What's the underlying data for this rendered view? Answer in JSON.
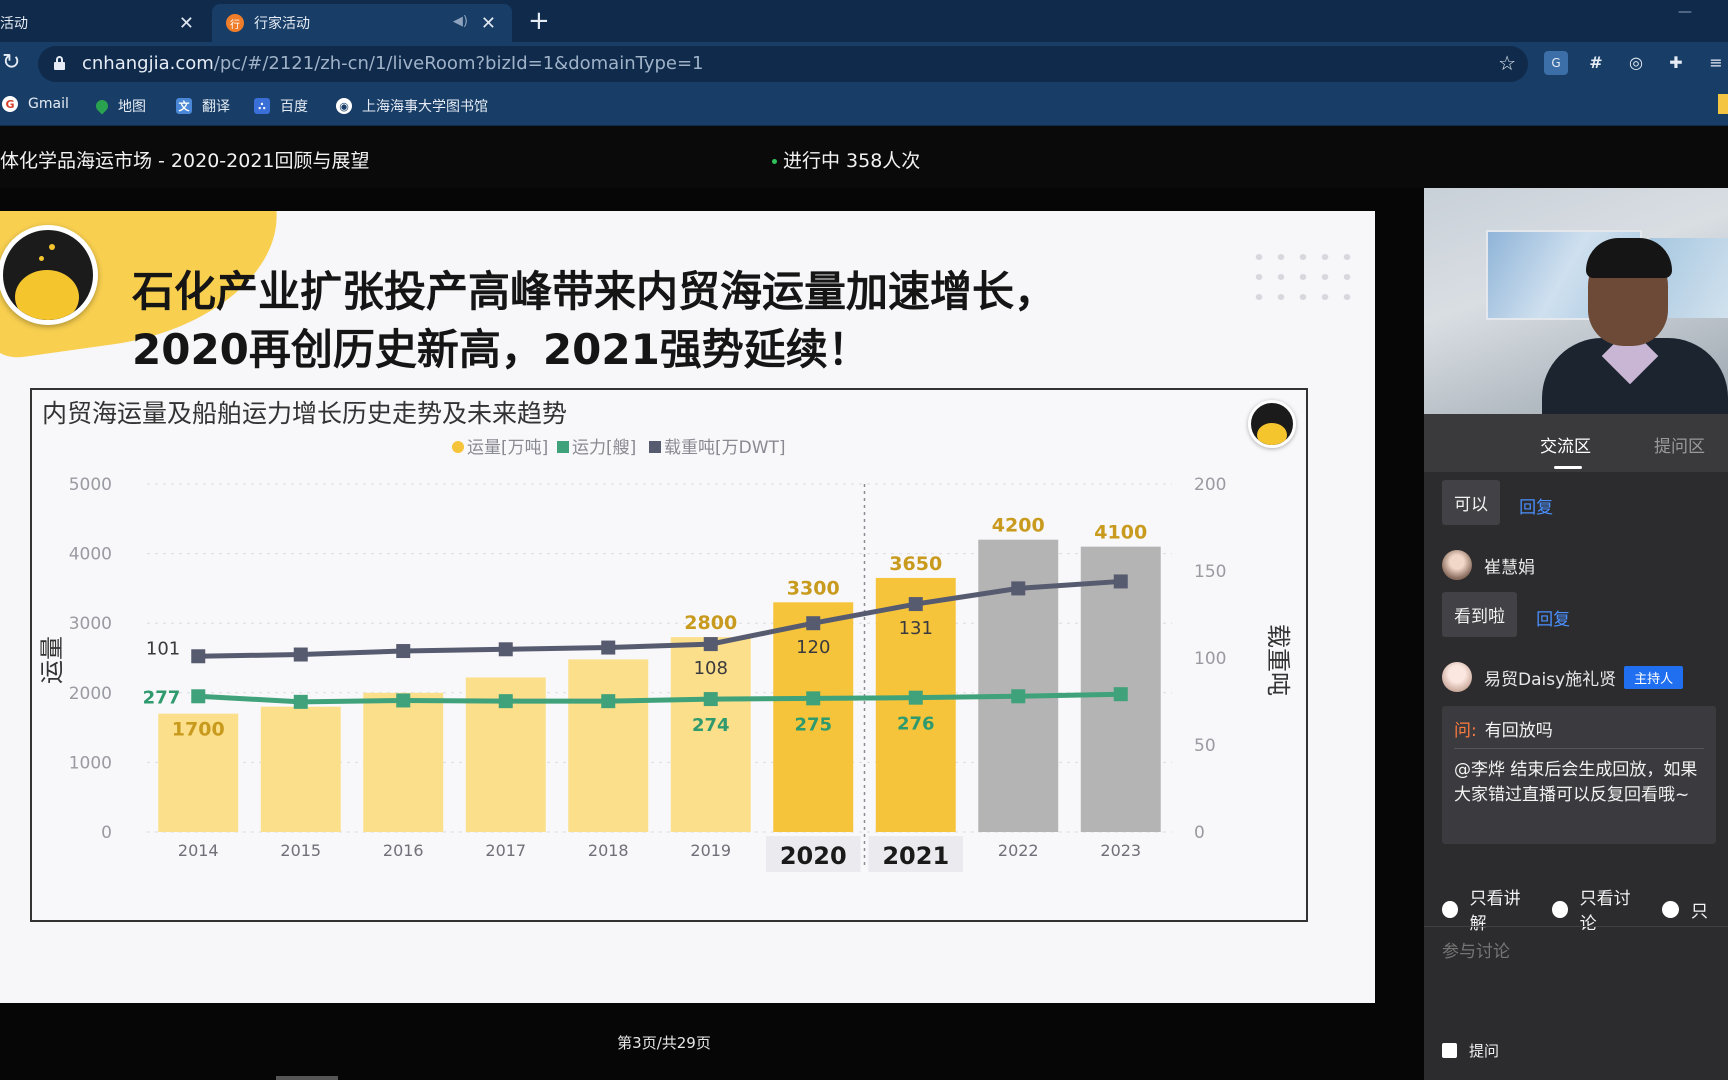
{
  "browser": {
    "tabs": [
      {
        "label": "活动",
        "active": false
      },
      {
        "label": "行家活动",
        "active": true
      }
    ],
    "favicon_text": "行",
    "new_tab_label": "+",
    "url_host": "cnhangjia.com",
    "url_path": "/pc/#/2121/zh-cn/1/liveRoom?bizId=1&domainType=1",
    "bookmarks": [
      "Gmail",
      "地图",
      "翻译",
      "百度",
      "上海海事大学图书馆"
    ]
  },
  "page": {
    "title": "体化学品海运市场 - 2020-2021回顾与展望",
    "status": "进行中 358人次"
  },
  "slide": {
    "headline_line1": "石化产业扩张投产高峰带来内贸海运量加速增长，",
    "headline_line2": "2020再创历史新高，2021强势延续！",
    "page_indicator": "第3页/共29页"
  },
  "chart_data": {
    "type": "bar",
    "title": "内贸海运量及船舶运力增长历史走势及未来趋势",
    "ylabel": "运量",
    "y2label": "载重吨",
    "ylim": [
      0,
      5000
    ],
    "y2lim": [
      0,
      200
    ],
    "yticks": [
      0,
      1000,
      2000,
      3000,
      4000,
      5000
    ],
    "y2ticks": [
      0,
      50,
      100,
      150,
      200
    ],
    "categories": [
      "2014",
      "2015",
      "2016",
      "2017",
      "2018",
      "2019",
      "2020",
      "2021",
      "2022",
      "2023"
    ],
    "emphasized_categories": [
      "2020",
      "2021"
    ],
    "legend_position": "top-center",
    "series": [
      {
        "name": "运量[万吨]",
        "kind": "bar",
        "axis": "left",
        "color": "#f9da7e",
        "values": [
          1700,
          1800,
          2000,
          2220,
          2480,
          2800,
          3300,
          3650,
          4200,
          4100
        ],
        "labels": [
          "1700",
          "",
          "",
          "",
          "",
          "2800",
          "3300",
          "3650",
          "4200",
          "4100"
        ],
        "bar_colors": [
          "#fbdf8a",
          "#fbdf8a",
          "#fbdf8a",
          "#fbdf8a",
          "#fbdf8a",
          "#fbdf8a",
          "#f6c43b",
          "#f6c43b",
          "#b4b4b4",
          "#b4b4b4"
        ]
      },
      {
        "name": "运力[艘]",
        "kind": "line",
        "axis": "left",
        "color": "#3fa27a",
        "values": [
          1950,
          1870,
          1890,
          1880,
          1880,
          1910,
          1920,
          1930,
          1950,
          1980
        ],
        "labels": [
          "277",
          "",
          "",
          "",
          "",
          "274",
          "275",
          "276",
          "",
          ""
        ]
      },
      {
        "name": "载重吨[万DWT]",
        "kind": "line",
        "axis": "right",
        "color": "#575b70",
        "values": [
          101,
          102,
          104,
          105,
          106,
          108,
          120,
          131,
          140,
          144
        ],
        "labels": [
          "101",
          "",
          "",
          "",
          "",
          "108",
          "120",
          "131",
          "",
          ""
        ]
      }
    ],
    "grid": true
  },
  "sidebar": {
    "tabs": [
      "交流区",
      "提问区"
    ],
    "messages": [
      {
        "text": "可以",
        "reply": "回复"
      },
      {
        "user": "崔慧娟",
        "text": "看到啦",
        "reply": "回复"
      }
    ],
    "host": {
      "name": "易贸Daisy施礼贤",
      "badge": "主持人",
      "question_prefix": "问:",
      "question": "有回放吗",
      "answer": "@李烨  结束后会生成回放，如果大家错过直播可以反复回看哦~"
    },
    "filters": [
      "只看讲解",
      "只看讨论",
      "只"
    ],
    "input_placeholder": "参与讨论",
    "ask_label": "提问"
  }
}
